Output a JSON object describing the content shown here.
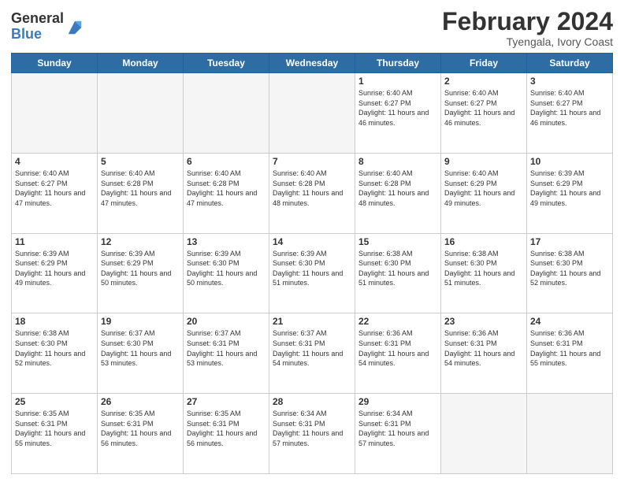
{
  "header": {
    "logo_general": "General",
    "logo_blue": "Blue",
    "month_year": "February 2024",
    "subtitle": "Tyengala, Ivory Coast"
  },
  "days_of_week": [
    "Sunday",
    "Monday",
    "Tuesday",
    "Wednesday",
    "Thursday",
    "Friday",
    "Saturday"
  ],
  "weeks": [
    [
      {
        "day": "",
        "empty": true
      },
      {
        "day": "",
        "empty": true
      },
      {
        "day": "",
        "empty": true
      },
      {
        "day": "",
        "empty": true
      },
      {
        "day": "1",
        "sunrise": "6:40 AM",
        "sunset": "6:27 PM",
        "daylight": "11 hours and 46 minutes."
      },
      {
        "day": "2",
        "sunrise": "6:40 AM",
        "sunset": "6:27 PM",
        "daylight": "11 hours and 46 minutes."
      },
      {
        "day": "3",
        "sunrise": "6:40 AM",
        "sunset": "6:27 PM",
        "daylight": "11 hours and 46 minutes."
      }
    ],
    [
      {
        "day": "4",
        "sunrise": "6:40 AM",
        "sunset": "6:27 PM",
        "daylight": "11 hours and 47 minutes."
      },
      {
        "day": "5",
        "sunrise": "6:40 AM",
        "sunset": "6:28 PM",
        "daylight": "11 hours and 47 minutes."
      },
      {
        "day": "6",
        "sunrise": "6:40 AM",
        "sunset": "6:28 PM",
        "daylight": "11 hours and 47 minutes."
      },
      {
        "day": "7",
        "sunrise": "6:40 AM",
        "sunset": "6:28 PM",
        "daylight": "11 hours and 48 minutes."
      },
      {
        "day": "8",
        "sunrise": "6:40 AM",
        "sunset": "6:28 PM",
        "daylight": "11 hours and 48 minutes."
      },
      {
        "day": "9",
        "sunrise": "6:40 AM",
        "sunset": "6:29 PM",
        "daylight": "11 hours and 49 minutes."
      },
      {
        "day": "10",
        "sunrise": "6:39 AM",
        "sunset": "6:29 PM",
        "daylight": "11 hours and 49 minutes."
      }
    ],
    [
      {
        "day": "11",
        "sunrise": "6:39 AM",
        "sunset": "6:29 PM",
        "daylight": "11 hours and 49 minutes."
      },
      {
        "day": "12",
        "sunrise": "6:39 AM",
        "sunset": "6:29 PM",
        "daylight": "11 hours and 50 minutes."
      },
      {
        "day": "13",
        "sunrise": "6:39 AM",
        "sunset": "6:30 PM",
        "daylight": "11 hours and 50 minutes."
      },
      {
        "day": "14",
        "sunrise": "6:39 AM",
        "sunset": "6:30 PM",
        "daylight": "11 hours and 51 minutes."
      },
      {
        "day": "15",
        "sunrise": "6:38 AM",
        "sunset": "6:30 PM",
        "daylight": "11 hours and 51 minutes."
      },
      {
        "day": "16",
        "sunrise": "6:38 AM",
        "sunset": "6:30 PM",
        "daylight": "11 hours and 51 minutes."
      },
      {
        "day": "17",
        "sunrise": "6:38 AM",
        "sunset": "6:30 PM",
        "daylight": "11 hours and 52 minutes."
      }
    ],
    [
      {
        "day": "18",
        "sunrise": "6:38 AM",
        "sunset": "6:30 PM",
        "daylight": "11 hours and 52 minutes."
      },
      {
        "day": "19",
        "sunrise": "6:37 AM",
        "sunset": "6:30 PM",
        "daylight": "11 hours and 53 minutes."
      },
      {
        "day": "20",
        "sunrise": "6:37 AM",
        "sunset": "6:31 PM",
        "daylight": "11 hours and 53 minutes."
      },
      {
        "day": "21",
        "sunrise": "6:37 AM",
        "sunset": "6:31 PM",
        "daylight": "11 hours and 54 minutes."
      },
      {
        "day": "22",
        "sunrise": "6:36 AM",
        "sunset": "6:31 PM",
        "daylight": "11 hours and 54 minutes."
      },
      {
        "day": "23",
        "sunrise": "6:36 AM",
        "sunset": "6:31 PM",
        "daylight": "11 hours and 54 minutes."
      },
      {
        "day": "24",
        "sunrise": "6:36 AM",
        "sunset": "6:31 PM",
        "daylight": "11 hours and 55 minutes."
      }
    ],
    [
      {
        "day": "25",
        "sunrise": "6:35 AM",
        "sunset": "6:31 PM",
        "daylight": "11 hours and 55 minutes."
      },
      {
        "day": "26",
        "sunrise": "6:35 AM",
        "sunset": "6:31 PM",
        "daylight": "11 hours and 56 minutes."
      },
      {
        "day": "27",
        "sunrise": "6:35 AM",
        "sunset": "6:31 PM",
        "daylight": "11 hours and 56 minutes."
      },
      {
        "day": "28",
        "sunrise": "6:34 AM",
        "sunset": "6:31 PM",
        "daylight": "11 hours and 57 minutes."
      },
      {
        "day": "29",
        "sunrise": "6:34 AM",
        "sunset": "6:31 PM",
        "daylight": "11 hours and 57 minutes."
      },
      {
        "day": "",
        "empty": true
      },
      {
        "day": "",
        "empty": true
      }
    ]
  ]
}
